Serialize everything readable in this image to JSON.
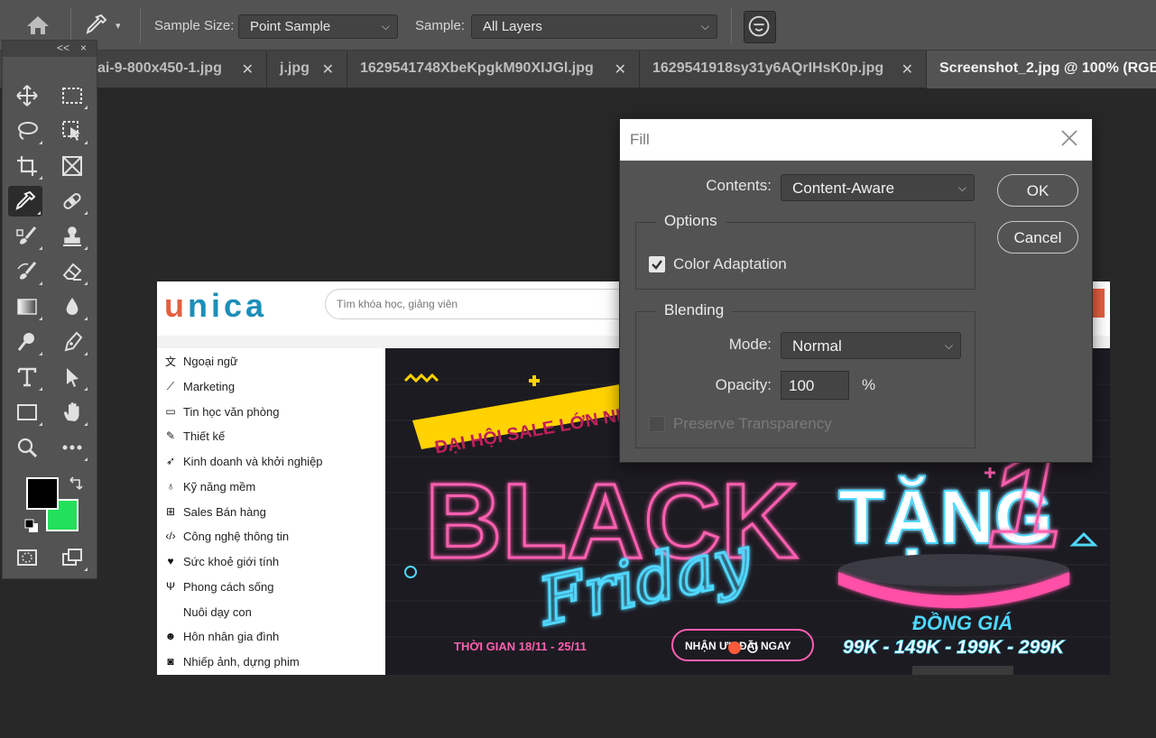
{
  "options_bar": {
    "sample_size_label": "Sample Size:",
    "sample_size_value": "Point Sample",
    "sample_label": "Sample:",
    "sample_value": "All Layers"
  },
  "tabs": [
    {
      "label": "ai-9-800x450-1.jpg"
    },
    {
      "label": "j.jpg"
    },
    {
      "label": "1629541748XbeKpgkM90XIJGl.jpg"
    },
    {
      "label": "1629541918sy31y6AQrIHsK0p.jpg"
    },
    {
      "label": "Screenshot_2.jpg @ 100% (RGB"
    }
  ],
  "toolbox": {
    "collapse_label": "<<",
    "close_label": "×",
    "foreground_color": "#000000",
    "background_color": "#22e05a"
  },
  "document": {
    "logo": "unica",
    "search_placeholder": "Tìm khóa học, giảng viên",
    "menu": [
      {
        "icon": "translate-icon",
        "label": "Ngoại ngữ"
      },
      {
        "icon": "chart-icon",
        "label": "Marketing"
      },
      {
        "icon": "monitor-icon",
        "label": "Tin học văn phòng"
      },
      {
        "icon": "brush-icon",
        "label": "Thiết kế"
      },
      {
        "icon": "rocket-icon",
        "label": "Kinh doanh và khởi nghiệp"
      },
      {
        "icon": "bulb-icon",
        "label": "Kỹ năng mềm"
      },
      {
        "icon": "cart-icon",
        "label": "Sales Bán hàng"
      },
      {
        "icon": "code-icon",
        "label": "Công nghệ thông tin"
      },
      {
        "icon": "heartbeat-icon",
        "label": "Sức khoẻ giới tính"
      },
      {
        "icon": "cutlery-icon",
        "label": "Phong cách sống"
      },
      {
        "icon": "child-icon",
        "label": "Nuôi dạy con"
      },
      {
        "icon": "family-icon",
        "label": "Hôn nhân gia đình"
      },
      {
        "icon": "camera-icon",
        "label": "Nhiếp ảnh, dựng phim"
      }
    ],
    "banner": {
      "ribbon": "ĐẠI HỘI SALE LỚN NH",
      "black": "BLACK",
      "friday": "Friday",
      "time": "THỜI GIAN 18/11 - 25/11",
      "cta": "NHẬN ƯU ĐÃI NGAY",
      "gift": "TẶNG",
      "number": "1",
      "same_price": "ĐỒNG GIÁ",
      "prices": "99K - 149K - 199K - 299K"
    }
  },
  "fill_dialog": {
    "title": "Fill",
    "contents_label": "Contents:",
    "contents_value": "Content-Aware",
    "ok_label": "OK",
    "cancel_label": "Cancel",
    "options_title": "Options",
    "color_adaptation_label": "Color Adaptation",
    "color_adaptation_checked": true,
    "blending_title": "Blending",
    "mode_label": "Mode:",
    "mode_value": "Normal",
    "opacity_label": "Opacity:",
    "opacity_value": "100",
    "opacity_unit": "%",
    "preserve_label": "Preserve Transparency",
    "preserve_checked": false
  }
}
